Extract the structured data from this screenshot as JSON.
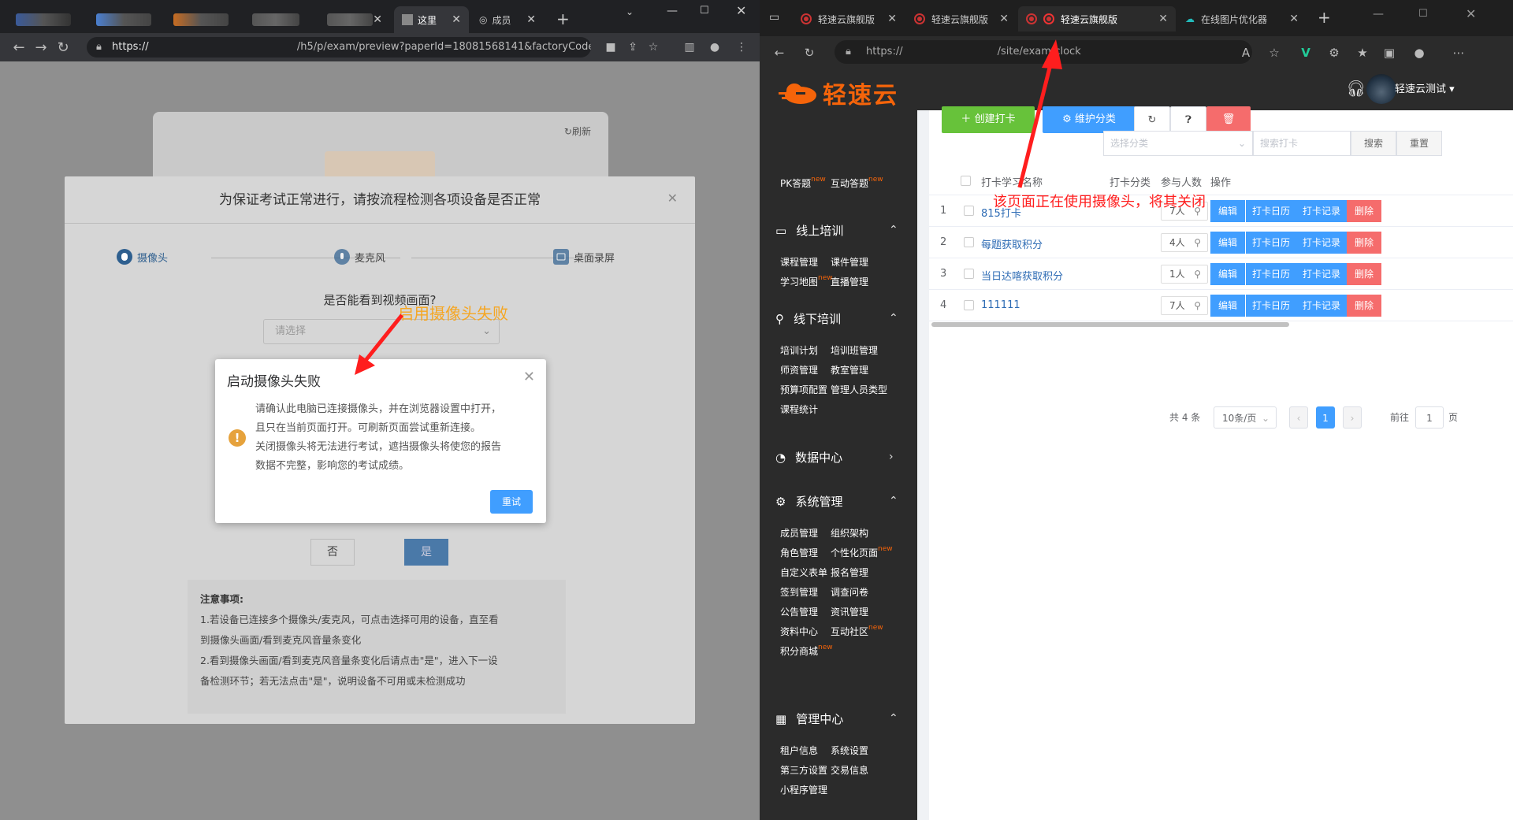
{
  "left_browser": {
    "address": {
      "prefix": "https://",
      "path": "/h5/p/exam/preview?paperId=18081568141&factoryCode=1..."
    },
    "tabs": [
      {
        "label": "这里"
      },
      {
        "label": "成员"
      }
    ],
    "page": {
      "refresh": "刷新",
      "dialog_title": "为保证考试正常进行，请按流程检测各项设备是否正常",
      "steps": [
        "摄像头",
        "麦克风",
        "桌面录屏"
      ],
      "question": "是否能看到视频画面?",
      "select_placeholder": "请选择",
      "no_label": "否",
      "yes_label": "是",
      "notes_title": "注意事项:",
      "notes": [
        "1.若设备已连接多个摄像头/麦克风，可点击选择可用的设备，直至看",
        "到摄像头画面/看到麦克风音量条变化",
        "2.看到摄像头画面/看到麦克风音量条变化后请点击\"是\"，进入下一设",
        "备检测环节；若无法点击\"是\"，说明设备不可用或未检测成功"
      ]
    },
    "modal": {
      "title": "启动摄像头失败",
      "body": [
        "请确认此电脑已连接摄像头，并在浏览器设置中打开，",
        "且只在当前页面打开。可刷新页面尝试重新连接。",
        "关闭摄像头将无法进行考试，遮挡摄像头将使您的报告",
        "数据不完整，影响您的考试成绩。"
      ],
      "retry": "重试"
    },
    "annotation": "启用摄像头失败"
  },
  "right_browser": {
    "tabs": [
      {
        "label": "轻速云旗舰版"
      },
      {
        "label": "轻速云旗舰版"
      },
      {
        "label": "轻速云旗舰版"
      },
      {
        "label": "在线图片优化器"
      }
    ],
    "address": {
      "prefix": "https://",
      "path": "/site/exam/clock"
    },
    "annotation": "该页面正在使用摄像头，将其关闭",
    "app": {
      "logo": "轻速云",
      "user": "轻速云测试",
      "top_items": [
        {
          "label": "PK答题",
          "new": "new"
        },
        {
          "label": "互动答题",
          "new": "new"
        }
      ],
      "groups": [
        {
          "title": "线上培训",
          "items": [
            "课程管理",
            "课件管理",
            "学习地图",
            "直播管理"
          ]
        },
        {
          "title": "线下培训",
          "items": [
            "培训计划",
            "培训班管理",
            "师资管理",
            "教室管理",
            "预算项配置",
            "管理人员类型",
            "课程统计"
          ]
        },
        {
          "title": "数据中心",
          "items": []
        },
        {
          "title": "系统管理",
          "items": [
            "成员管理",
            "组织架构",
            "角色管理",
            "个性化页面",
            "自定义表单",
            "报名管理",
            "签到管理",
            "调查问卷",
            "公告管理",
            "资讯管理",
            "资料中心",
            "互动社区",
            "积分商城"
          ]
        },
        {
          "title": "管理中心",
          "items": [
            "租户信息",
            "系统设置",
            "第三方设置",
            "交易信息",
            "小程序管理"
          ]
        }
      ],
      "new_badge": "new",
      "toolbar": {
        "create": "创建打卡",
        "maintain": "维护分类"
      },
      "filter": {
        "category_placeholder": "选择分类",
        "search_placeholder": "搜索打卡",
        "search": "搜索",
        "reset": "重置"
      },
      "columns": [
        "打卡学习名称",
        "打卡分类",
        "参与人数",
        "操作"
      ],
      "rows": [
        {
          "idx": "1",
          "name": "815打卡",
          "count": "7人"
        },
        {
          "idx": "2",
          "name": "每题获取积分",
          "count": "4人"
        },
        {
          "idx": "3",
          "name": "当日达喀获取积分",
          "count": "1人"
        },
        {
          "idx": "4",
          "name": "111111",
          "count": "7人"
        }
      ],
      "actions": [
        "编辑",
        "打卡日历",
        "打卡记录",
        "删除"
      ],
      "pager": {
        "total": "共 4 条",
        "size": "10条/页",
        "current": "1",
        "goto": "前往",
        "goto_value": "1",
        "page": "页"
      }
    }
  },
  "colors": {
    "primary": "#409eff",
    "orange": "#f5640a",
    "green": "#67c23a",
    "danger": "#f56c6c"
  }
}
